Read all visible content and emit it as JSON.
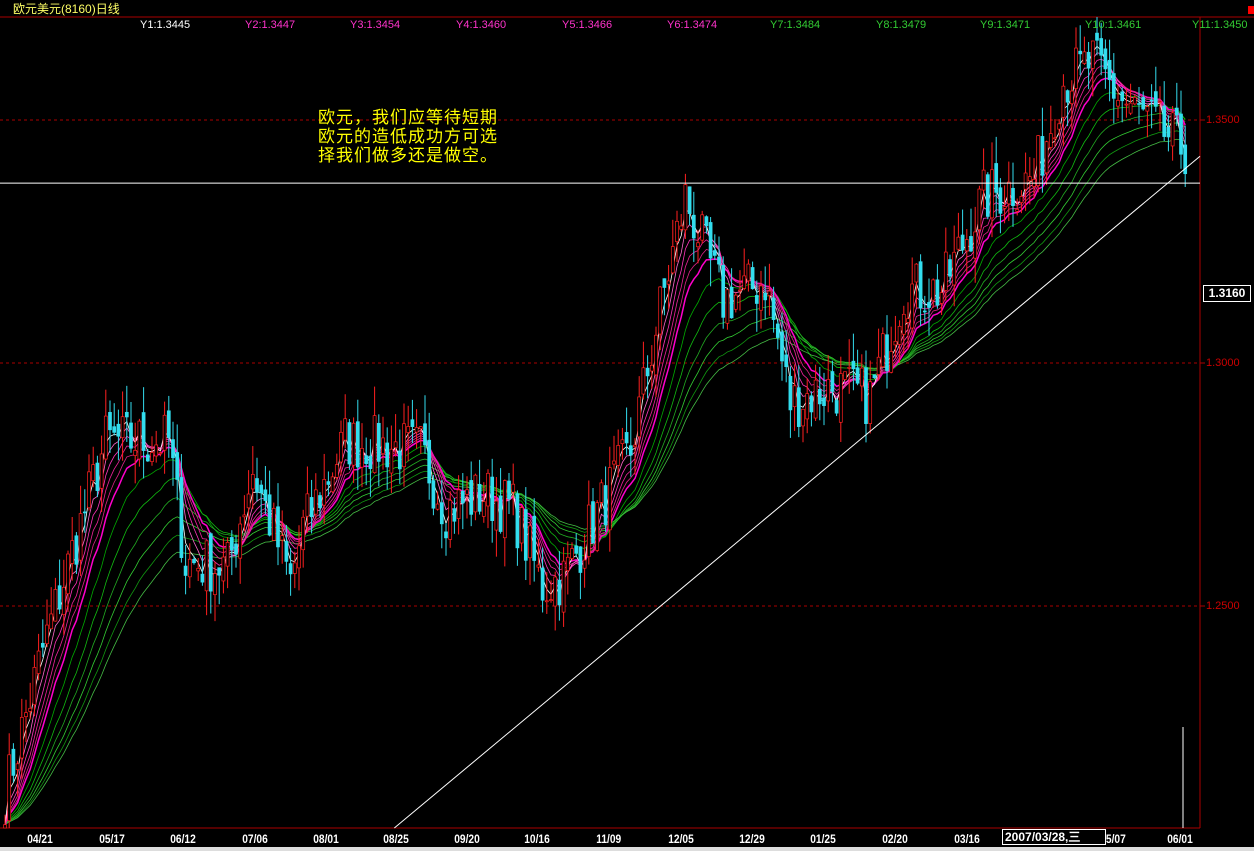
{
  "title": "欧元美元(8160)日线",
  "ma_labels": [
    {
      "text": "Y1:1.3445",
      "color": "#ffffff"
    },
    {
      "text": "Y2:1.3447",
      "color": "#ff33cc"
    },
    {
      "text": "Y3:1.3454",
      "color": "#ff33cc"
    },
    {
      "text": "Y4:1.3460",
      "color": "#ff33cc"
    },
    {
      "text": "Y5:1.3466",
      "color": "#ff33cc"
    },
    {
      "text": "Y6:1.3474",
      "color": "#ff33cc"
    },
    {
      "text": "Y7:1.3484",
      "color": "#33cc33"
    },
    {
      "text": "Y8:1.3479",
      "color": "#33cc33"
    },
    {
      "text": "Y9:1.3471",
      "color": "#33cc33"
    },
    {
      "text": "Y10:1.3461",
      "color": "#33cc33"
    },
    {
      "text": "Y11:1.3450",
      "color": "#33cc33"
    }
  ],
  "annotation": [
    "欧元，我们应等待短期",
    "欧元的造低成功方可选",
    "择我们做多还是做空。"
  ],
  "current_price": "1.3160",
  "tooltip": "2007/03/28,三",
  "chart_data": {
    "type": "candlestick",
    "title": "欧元美元(8160)日线",
    "ylim": [
      1.175,
      1.3705
    ],
    "yticks": [
      "1.3500",
      "1.3000",
      "1.2500"
    ],
    "xticks": [
      "04/21",
      "05/17",
      "06/12",
      "07/06",
      "08/01",
      "08/25",
      "09/20",
      "10/16",
      "11/09",
      "12/05",
      "12/29",
      "01/25",
      "02/20",
      "03/16",
      "05/07",
      "06/01"
    ],
    "bars": 282,
    "close_waypoints": [
      [
        0,
        1.211
      ],
      [
        9,
        1.241
      ],
      [
        24,
        1.284
      ],
      [
        39,
        1.284
      ],
      [
        43,
        1.259
      ],
      [
        53,
        1.258
      ],
      [
        59,
        1.278
      ],
      [
        68,
        1.255
      ],
      [
        71,
        1.266
      ],
      [
        81,
        1.284
      ],
      [
        99,
        1.282
      ],
      [
        105,
        1.27
      ],
      [
        114,
        1.273
      ],
      [
        121,
        1.27
      ],
      [
        128,
        1.254
      ],
      [
        133,
        1.256
      ],
      [
        149,
        1.282
      ],
      [
        156,
        1.311
      ],
      [
        162,
        1.334
      ],
      [
        171,
        1.313
      ],
      [
        177,
        1.315
      ],
      [
        181,
        1.317
      ],
      [
        187,
        1.292
      ],
      [
        197,
        1.295
      ],
      [
        206,
        1.293
      ],
      [
        214,
        1.315
      ],
      [
        223,
        1.315
      ],
      [
        233,
        1.334
      ],
      [
        245,
        1.338
      ],
      [
        252,
        1.358
      ],
      [
        259,
        1.362
      ],
      [
        266,
        1.354
      ],
      [
        281,
        1.344
      ]
    ],
    "horizontal_line": 1.337,
    "trendline": [
      [
        52,
        1.175
      ],
      [
        281,
        1.34
      ]
    ],
    "ma_periods_short": [
      3,
      5,
      7,
      9,
      11,
      13
    ],
    "ma_periods_long": [
      18,
      24,
      30,
      36,
      42,
      48
    ],
    "colors": {
      "up": "#ff2020",
      "down": "#33ddee",
      "grid": "#aa0000"
    }
  }
}
